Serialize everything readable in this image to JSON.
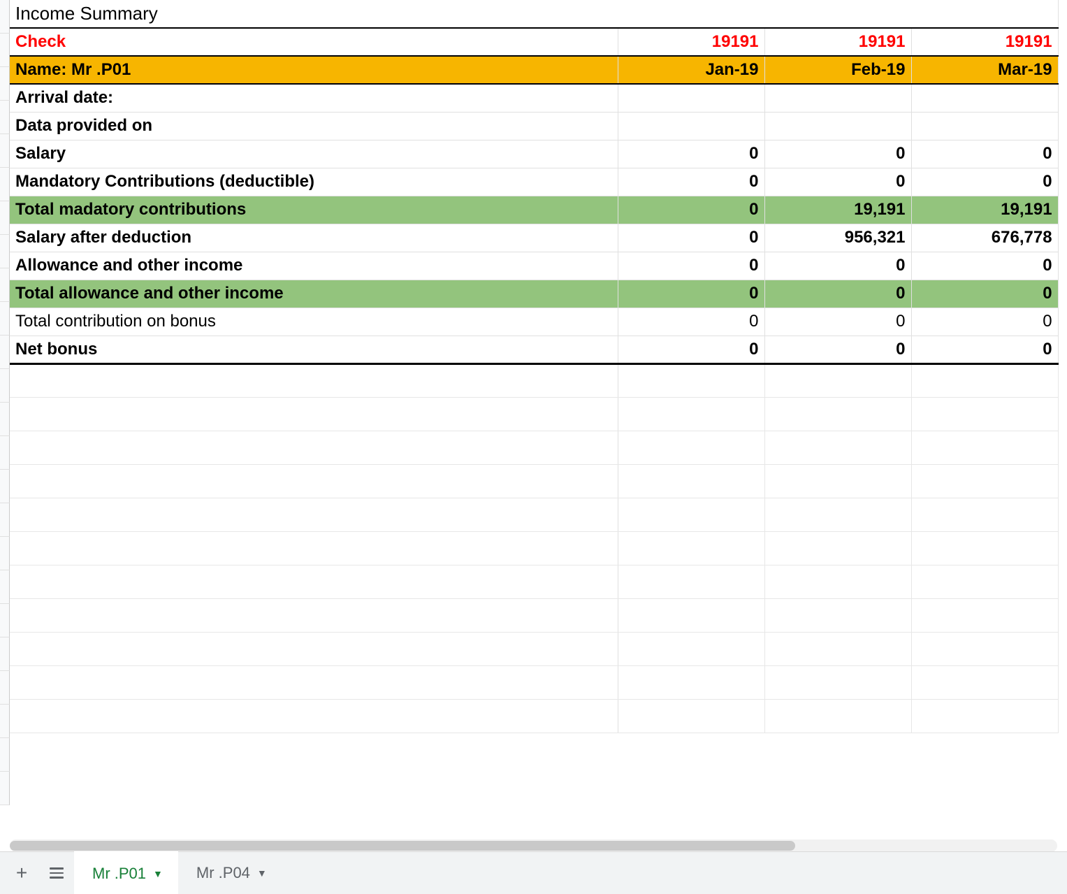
{
  "title": "Income Summary",
  "check": {
    "label": "Check",
    "values": [
      "19191",
      "19191",
      "19191"
    ]
  },
  "header": {
    "name_label": "Name: Mr .P01",
    "months": [
      "Jan-19",
      "Feb-19",
      "Mar-19"
    ]
  },
  "rows": [
    {
      "label": "Arrival date:",
      "values": [
        "",
        "",
        ""
      ],
      "style": "bold"
    },
    {
      "label": "Data provided on",
      "values": [
        "",
        "",
        ""
      ],
      "style": "bold"
    },
    {
      "label": "Salary",
      "values": [
        "0",
        "0",
        "0"
      ],
      "style": "bold"
    },
    {
      "label": "Mandatory Contributions (deductible)",
      "values": [
        "0",
        "0",
        "0"
      ],
      "style": "bold"
    },
    {
      "label": "Total madatory contributions",
      "values": [
        "0",
        "19,191",
        "19,191"
      ],
      "style": "green"
    },
    {
      "label": "Salary after deduction",
      "values": [
        "0",
        "956,321",
        "676,778"
      ],
      "style": "bold"
    },
    {
      "label": "Allowance and other income",
      "values": [
        "0",
        "0",
        "0"
      ],
      "style": "bold"
    },
    {
      "label": "Total allowance and other income",
      "values": [
        "0",
        "0",
        "0"
      ],
      "style": "green"
    },
    {
      "label": "Total contribution on bonus",
      "values": [
        "0",
        "0",
        "0"
      ],
      "style": "normal"
    },
    {
      "label": "Net bonus",
      "values": [
        "0",
        "0",
        "0"
      ],
      "style": "bold",
      "last": true
    }
  ],
  "tabs": {
    "active": "Mr .P01",
    "inactive": "Mr .P04"
  }
}
